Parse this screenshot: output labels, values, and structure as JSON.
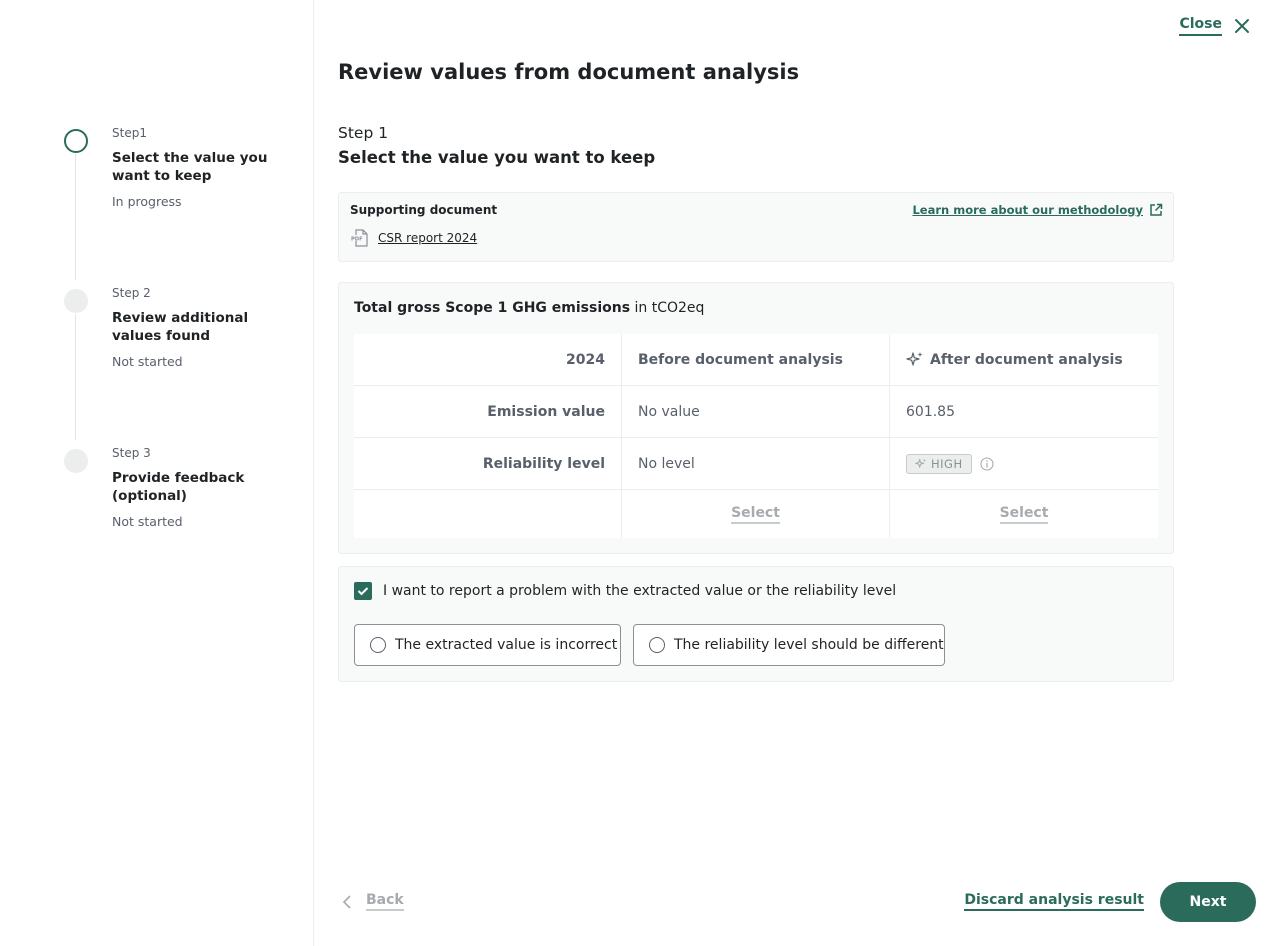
{
  "stepper": {
    "steps": [
      {
        "kicker": "Step1",
        "title": "Select the value you want to keep",
        "status": "In progress"
      },
      {
        "kicker": "Step 2",
        "title": "Review additional values found",
        "status": "Not started"
      },
      {
        "kicker": "Step 3",
        "title": "Provide feedback (optional)",
        "status": "Not started"
      }
    ]
  },
  "header": {
    "close_label": "Close",
    "page_title": "Review values from document analysis"
  },
  "current_step": {
    "kicker": "Step 1",
    "title": "Select the value you want to keep"
  },
  "supporting_document": {
    "label": "Supporting document",
    "file_name": "CSR report 2024",
    "file_type": "PDF",
    "methodology_link": "Learn more about our methodology"
  },
  "comparison": {
    "metric_name": "Total gross Scope 1 GHG emissions",
    "unit_text": "in tCO2eq",
    "columns": [
      "2024",
      "Before document analysis",
      "After document analysis"
    ],
    "rows": [
      {
        "label": "Emission value",
        "before": "No value",
        "after": "601.85"
      },
      {
        "label": "Reliability level",
        "before": "No level",
        "after": "HIGH"
      }
    ],
    "select_label": "Select"
  },
  "report": {
    "checkbox_label": "I want to report a problem with the extracted value or the reliability level",
    "checked": true,
    "options": [
      "The extracted value is incorrect",
      "The reliability level should be different"
    ]
  },
  "footer": {
    "back_label": "Back",
    "discard_label": "Discard analysis result",
    "next_label": "Next"
  },
  "colors": {
    "accent": "#2a6b5c",
    "muted": "#59606b",
    "panel_bg": "#f8f9f9"
  }
}
